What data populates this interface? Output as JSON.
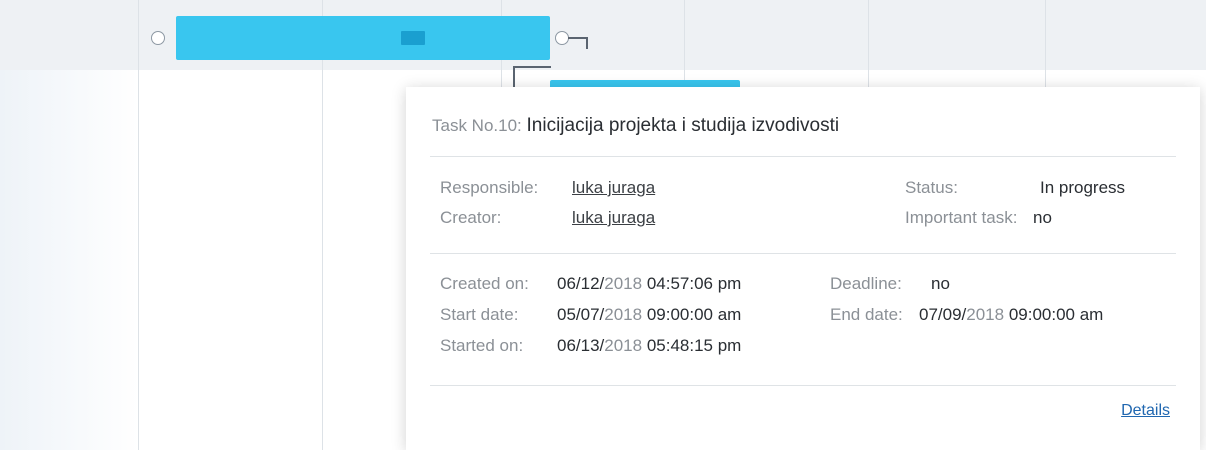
{
  "task": {
    "number_label": "Task No.10:",
    "name": "Inicijacija projekta i studija izvodivosti",
    "responsible_label": "Responsible:",
    "responsible": "luka juraga",
    "creator_label": "Creator:",
    "creator": "luka juraga",
    "status_label": "Status:",
    "status": "In progress",
    "important_label": "Important task:",
    "important": "no",
    "created_on_label": "Created on:",
    "created_on": {
      "md": "06/12/",
      "year": "2018",
      "time": " 04:57:06 pm"
    },
    "start_date_label": "Start date:",
    "start_date": {
      "md": "05/07/",
      "year": "2018",
      "time": " 09:00:00 am"
    },
    "started_on_label": "Started on:",
    "started_on": {
      "md": "06/13/",
      "year": "2018",
      "time": " 05:48:15 pm"
    },
    "deadline_label": "Deadline:",
    "deadline": "no",
    "end_date_label": "End date:",
    "end_date": {
      "md": "07/09/",
      "year": "2018",
      "time": " 09:00:00 am"
    },
    "details_link": "Details"
  },
  "colors": {
    "task_bar": "#39c6ef",
    "progress": "#1a9fd0",
    "link": "#2067b0"
  }
}
